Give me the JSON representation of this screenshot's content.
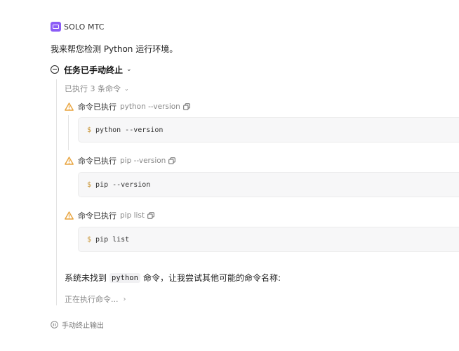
{
  "header": {
    "app_name": "SOLO MTC",
    "icon": "app-window-icon",
    "accent": "#8b5cf6"
  },
  "message": {
    "intro": "我来帮您检测 Python 运行环境。"
  },
  "task": {
    "title": "任务已手动终止",
    "status_icon": "minus-circle-icon",
    "executed_count": "已执行 3 条命令",
    "commands": [
      {
        "status_label": "命令已执行",
        "name": "python --version",
        "prompt": "$",
        "code": "python --version"
      },
      {
        "status_label": "命令已执行",
        "name": "pip --version",
        "prompt": "$",
        "code": "pip --version"
      },
      {
        "status_label": "命令已执行",
        "name": "pip list",
        "prompt": "$",
        "code": "pip list"
      }
    ],
    "summary_before": "系统未找到",
    "summary_code": "python",
    "summary_after": "命令，让我尝试其他可能的命令名称:",
    "running": "正在执行命令..."
  },
  "footer": {
    "label": "手动终止输出",
    "icon": "pause-icon"
  },
  "colors": {
    "warning": "#e8a33d",
    "prompt_dollar": "#c89230"
  }
}
